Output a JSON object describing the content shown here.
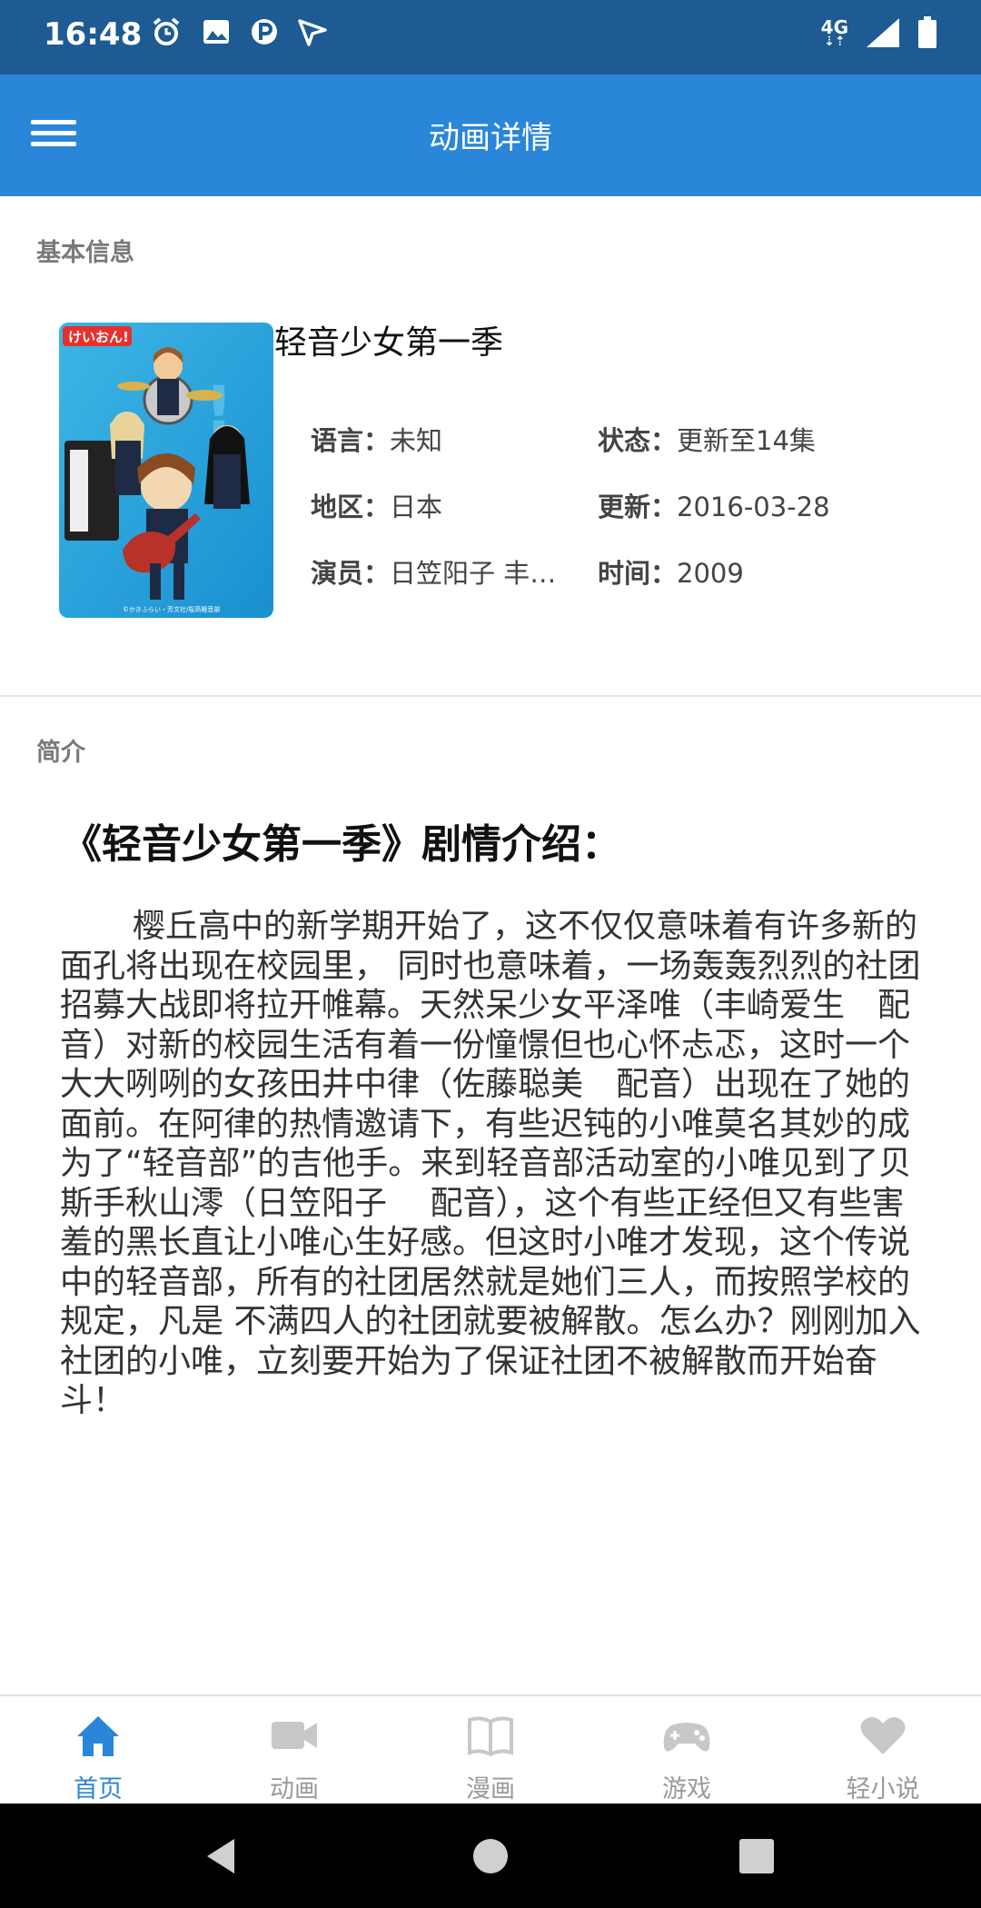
{
  "status_bar": {
    "time": "16:48",
    "network": "4G",
    "icons": [
      "alarm-icon",
      "image-icon",
      "parking-icon",
      "send-icon",
      "signal-icon",
      "battery-icon"
    ]
  },
  "app_bar": {
    "title": "动画详情",
    "menu_icon": "hamburger-menu-icon"
  },
  "basic_info": {
    "section_label": "基本信息",
    "title": "轻音少女第一季",
    "fields": {
      "language_key": "语言：",
      "language_value": "未知",
      "status_key": "状态：",
      "status_value": "更新至14集",
      "region_key": "地区：",
      "region_value": "日本",
      "update_key": "更新：",
      "update_value": "2016-03-28",
      "cast_key": "演员：",
      "cast_value": "日笠阳子 丰…",
      "year_key": "时间：",
      "year_value": "2009"
    }
  },
  "synopsis": {
    "section_label": "简介",
    "heading": "《轻音少女第一季》剧情介绍：",
    "body": "樱丘高中的新学期开始了，这不仅仅意味着有许多新的面孔将出现在校园里， 同时也意味着，一场轰轰烈烈的社团招募大战即将拉开帷幕。天然呆少女平泽唯（丰崎爱生　配音）对新的校园生活有着一份憧憬但也心怀忐忑，这时一个大大咧咧的女孩田井中律（佐藤聪美　配音）出现在了她的面前。在阿律的热情邀请下，有些迟钝的小唯莫名其妙的成为了“轻音部”的吉他手。来到轻音部活动室的小唯见到了贝斯手秋山澪（日笠阳子　 配音），这个有些正经但又有些害羞的黑长直让小唯心生好感。但这时小唯才发现，这个传说中的轻音部，所有的社团居然就是她们三人，而按照学校的规定，凡是 不满四人的社团就要被解散。怎么办？刚刚加入社团的小唯，立刻要开始为了保证社团不被解散而开始奋斗！"
  },
  "bottom_nav": {
    "items": [
      {
        "label": "首页",
        "icon": "home-icon",
        "active": true
      },
      {
        "label": "动画",
        "icon": "video-camera-icon",
        "active": false
      },
      {
        "label": "漫画",
        "icon": "book-icon",
        "active": false
      },
      {
        "label": "游戏",
        "icon": "gamepad-icon",
        "active": false
      },
      {
        "label": "轻小说",
        "icon": "heart-icon",
        "active": false
      }
    ]
  },
  "colors": {
    "status_bar": "#1d5b92",
    "app_bar": "#2a86d8",
    "active_tab": "#2a86d8",
    "inactive_tab": "#c8c8c8"
  }
}
